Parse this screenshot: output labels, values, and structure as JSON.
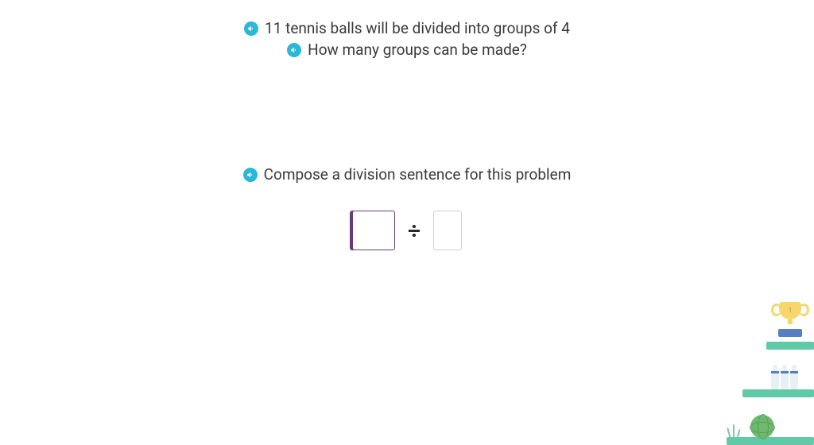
{
  "problem": {
    "line1": "11 tennis balls will be divided into groups of 4",
    "line2": "How many groups can be made?"
  },
  "instruction": "Compose a division sentence for this problem",
  "equation": {
    "dividend": "",
    "operator": "÷",
    "divisor": ""
  },
  "trophy_label": "1"
}
